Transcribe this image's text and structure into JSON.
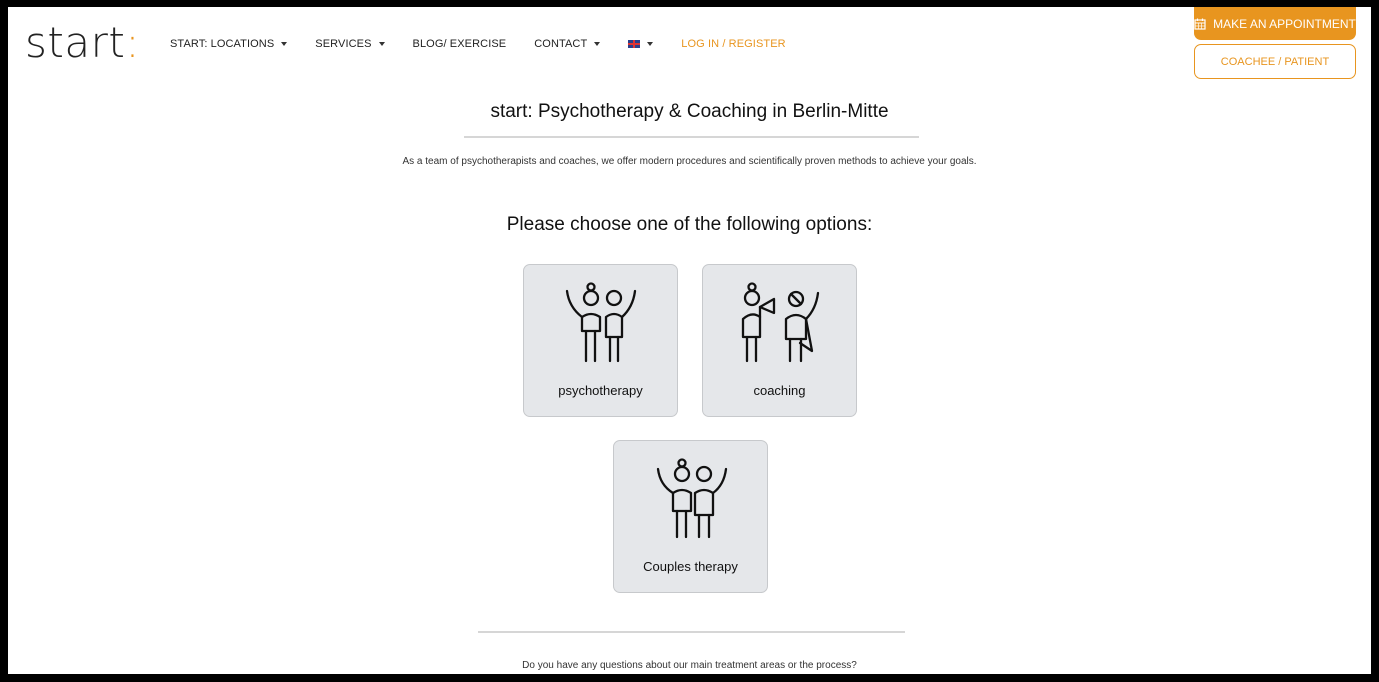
{
  "header": {
    "logo_text": "start",
    "logo_colon": ":",
    "nav": [
      {
        "label": "START: LOCATIONS",
        "dropdown": true
      },
      {
        "label": "SERVICES",
        "dropdown": true
      },
      {
        "label": "BLOG/ EXERCISE",
        "dropdown": false
      },
      {
        "label": "CONTACT",
        "dropdown": true
      }
    ],
    "language_icon": "uk-flag-icon",
    "login_label": "LOG IN / REGISTER",
    "appointment_label": "MAKE AN APPOINTMENT",
    "appointment_icon": "calendar-icon",
    "coachee_label": "COACHEE / PATIENT"
  },
  "main": {
    "headline": "start: Psychotherapy & Coaching in Berlin-Mitte",
    "intro": "As a team of psychotherapists and coaches, we offer modern procedures and scientifically proven methods to achieve your goals.",
    "choose_title": "Please choose one of the following options:",
    "options": [
      {
        "label": "psychotherapy",
        "icon": "two-people-icon"
      },
      {
        "label": "coaching",
        "icon": "coach-megaphone-icon"
      },
      {
        "label": "Couples therapy",
        "icon": "couple-icon"
      }
    ],
    "question": "Do you have any questions about our main treatment areas or the process?"
  },
  "colors": {
    "accent": "#e8951f",
    "card_bg": "#e5e7ea",
    "divider": "#d6d6d6"
  }
}
